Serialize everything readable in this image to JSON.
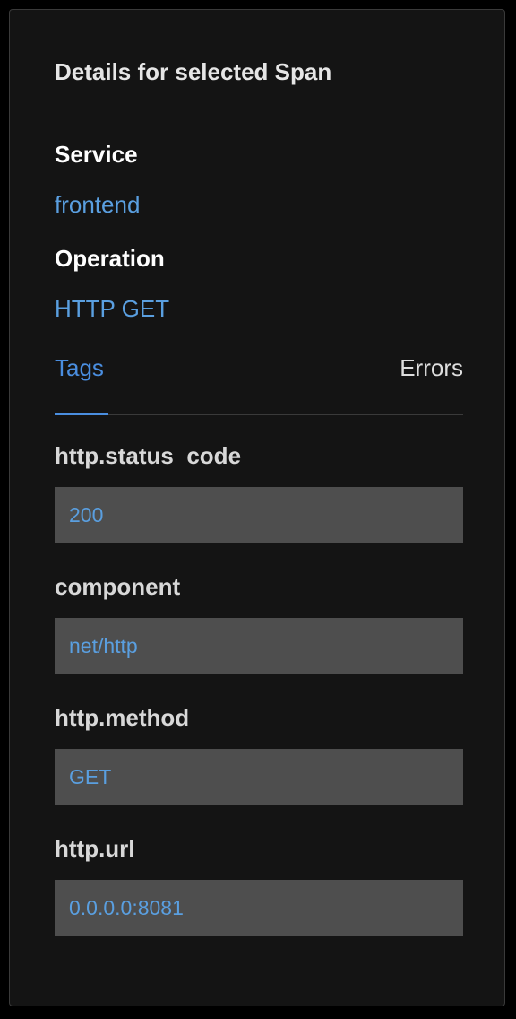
{
  "panel": {
    "title": "Details for selected Span",
    "service_label": "Service",
    "service_value": "frontend",
    "operation_label": "Operation",
    "operation_value": "HTTP GET"
  },
  "tabs": [
    {
      "label": "Tags",
      "active": true
    },
    {
      "label": "Errors",
      "active": false
    }
  ],
  "tags": [
    {
      "key": "http.status_code",
      "value": "200"
    },
    {
      "key": "component",
      "value": "net/http"
    },
    {
      "key": "http.method",
      "value": "GET"
    },
    {
      "key": "http.url",
      "value": "0.0.0.0:8081"
    }
  ],
  "colors": {
    "background": "#000000",
    "panel": "#141414",
    "accent": "#4a8ee0",
    "link": "#5a9fe0",
    "tag_box": "#4e4e4e"
  }
}
